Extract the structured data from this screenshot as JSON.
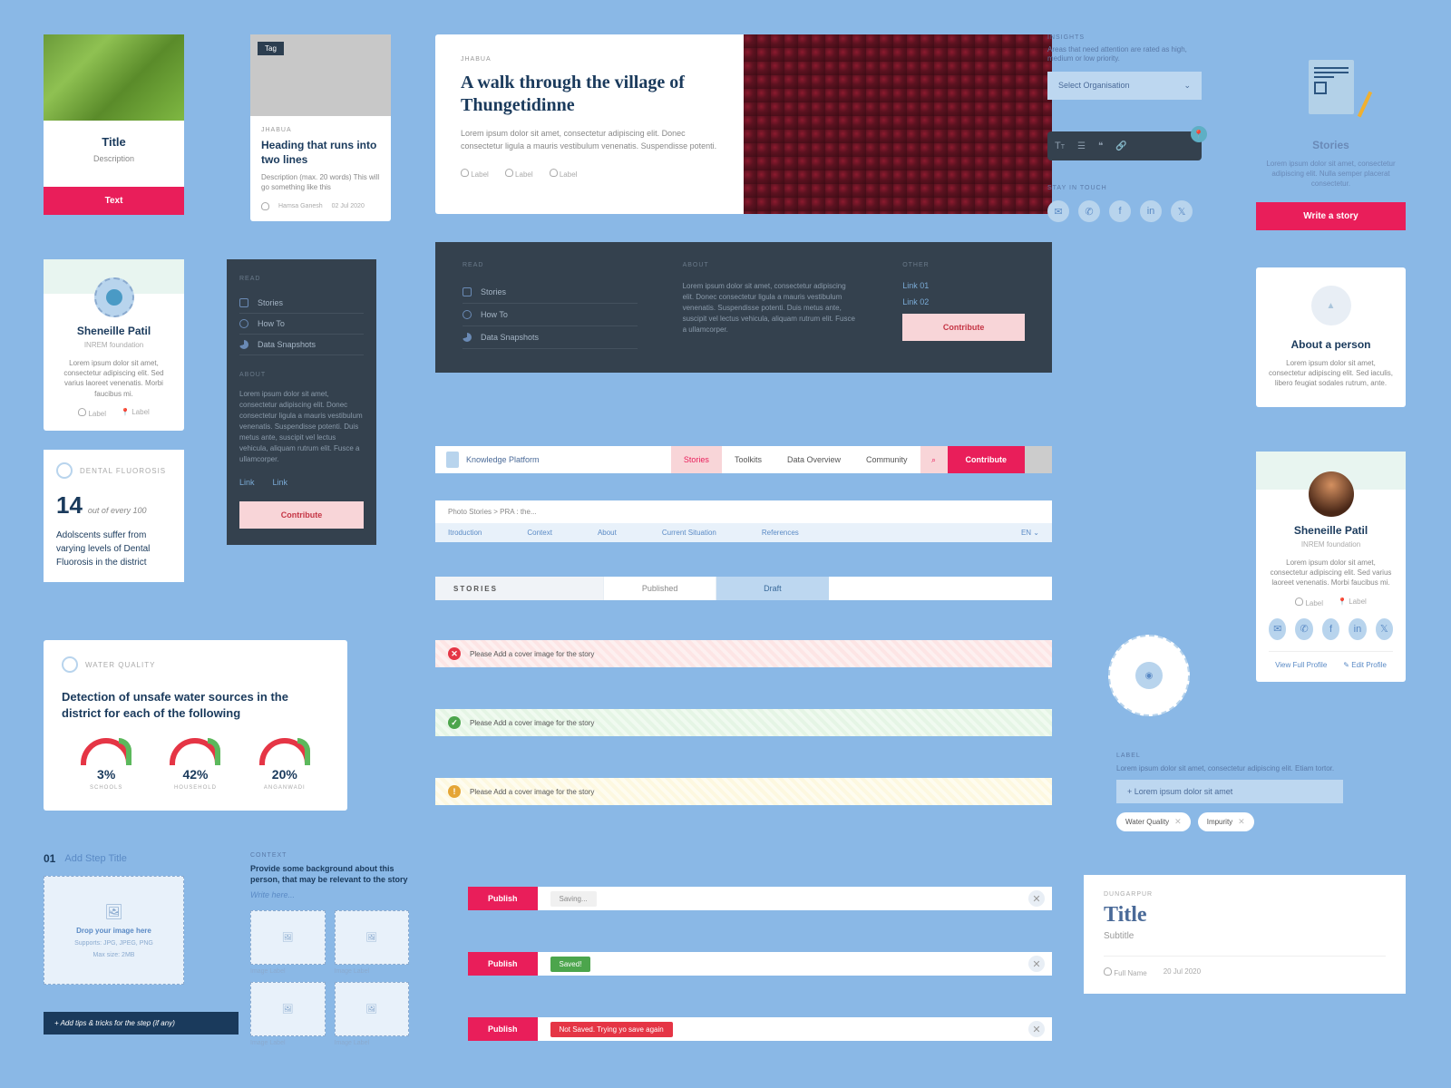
{
  "card1": {
    "title": "Title",
    "desc": "Description",
    "button": "Text"
  },
  "card2": {
    "tag": "Tag",
    "category": "JHABUA",
    "heading": "Heading that runs into two lines",
    "desc": "Description (max. 20 words) This will go something like this",
    "author": "Hamsa Ganesh",
    "date": "02 Jul 2020"
  },
  "featured": {
    "category": "JHABUA",
    "title": "A walk through the village of Thungetidinne",
    "desc": "Lorem ipsum dolor sit amet, consectetur adipiscing elit. Donec consectetur ligula a mauris vestibulum venenatis. Suspendisse potenti.",
    "labels": [
      "Label",
      "Label",
      "Label"
    ]
  },
  "insights": {
    "label": "INSIGHTS",
    "sub": "Areas that need attention are rated as high, medium or low priority.",
    "placeholder": "Select Organisation"
  },
  "stayintouch": {
    "label": "STAY IN TOUCH"
  },
  "stories_card": {
    "title": "Stories",
    "desc": "Lorem ipsum dolor sit amet, consectetur adipiscing elit. Nulla semper placerat consectetur.",
    "button": "Write a story"
  },
  "person1": {
    "name": "Sheneille Patil",
    "org": "INREM foundation",
    "bio": "Lorem ipsum dolor sit amet, consectetur adipiscing elit. Sed varius laoreet venenatis. Morbi faucibus mi.",
    "labels": [
      "Label",
      "Label"
    ]
  },
  "sidebar": {
    "section1": "READ",
    "items": [
      "Stories",
      "How To",
      "Data Snapshots"
    ],
    "section2": "ABOUT",
    "about_text": "Lorem ipsum dolor sit amet, consectetur adipiscing elit. Donec consectetur ligula a mauris vestibulum venenatis. Suspendisse potenti. Duis metus ante, suscipit vel lectus vehicula, aliquam rutrum elit. Fusce a ullamcorper.",
    "links": [
      "Link",
      "Link"
    ],
    "button": "Contribute"
  },
  "footer": {
    "read_label": "READ",
    "read_items": [
      "Stories",
      "How To",
      "Data Snapshots"
    ],
    "about_label": "ABOUT",
    "about_text": "Lorem ipsum dolor sit amet, consectetur adipiscing elit. Donec consectetur ligula a mauris vestibulum venenatis. Suspendisse potenti. Duis metus ante, suscipit vel lectus vehicula, aliquam rutrum elit. Fusce a ullamcorper.",
    "other_label": "OTHER",
    "other_links": [
      "Link 01",
      "Link 02"
    ],
    "button": "Contribute"
  },
  "nav": {
    "brand": "Knowledge Platform",
    "items": [
      "Stories",
      "Toolkits",
      "Data Overview",
      "Community"
    ],
    "button": "Contribute"
  },
  "breadcrumb": {
    "path": "Photo Stories > PRA : the...",
    "tabs": [
      "Itroduction",
      "Context",
      "About",
      "Current Situation",
      "References"
    ],
    "lang": "EN"
  },
  "stories_tabs": {
    "label": "STORIES",
    "tabs": [
      "Published",
      "Draft"
    ]
  },
  "stat": {
    "header": "DENTAL FLUOROSIS",
    "number": "14",
    "per": "out of every 100",
    "desc": "Adolscents suffer from varying levels of Dental Fluorosis in the district"
  },
  "waterq": {
    "header": "WATER QUALITY",
    "title": "Detection of unsafe water sources in the district for each of the following",
    "gauges": [
      {
        "val": "3%",
        "label": "SCHOOLS"
      },
      {
        "val": "42%",
        "label": "HOUSEHOLD"
      },
      {
        "val": "20%",
        "label": "ANGANWADI"
      }
    ]
  },
  "alerts": {
    "msg": "Please Add a cover image for the story"
  },
  "about_person": {
    "title": "About a person",
    "desc": "Lorem ipsum dolor sit amet, consectetur adipiscing elit. Sed iaculis, libero feugiat sodales rutrum, ante."
  },
  "person2": {
    "name": "Sheneille Patil",
    "org": "INREM foundation",
    "bio": "Lorem ipsum dolor sit amet, consectetur adipiscing elit. Sed varius laoreet venenatis. Morbi faucibus mi.",
    "labels": [
      "Label",
      "Label"
    ],
    "view": "View Full Profile",
    "edit": "Edit Profile"
  },
  "label_chips": {
    "label": "LABEL",
    "sub": "Lorem ipsum dolor sit amet, consectetur adipiscing elit. Etiam tortor.",
    "placeholder": "+  Lorem ipsum dolor sit amet",
    "chips": [
      "Water Quality",
      "Impurity"
    ]
  },
  "step": {
    "num": "01",
    "title": "Add Step Title",
    "drop_title": "Drop your image here",
    "formats": "Supports: JPG, JPEG, PNG",
    "max": "Max size: 2MB"
  },
  "tips": "+ Add tips & tricks for the step (if any)",
  "context": {
    "label": "CONTEXT",
    "sub": "Provide some background about this person, that may be relevant to the story",
    "placeholder": "Write here...",
    "img_label": "Image Label"
  },
  "publish": {
    "button": "Publish",
    "saving": "Saving...",
    "saved": "Saved!",
    "error": "Not Saved. Trying yo save again"
  },
  "titlecard": {
    "category": "DUNGARPUR",
    "title": "Title",
    "subtitle": "Subtitle",
    "author": "Full Name",
    "date": "20 Jul 2020"
  }
}
